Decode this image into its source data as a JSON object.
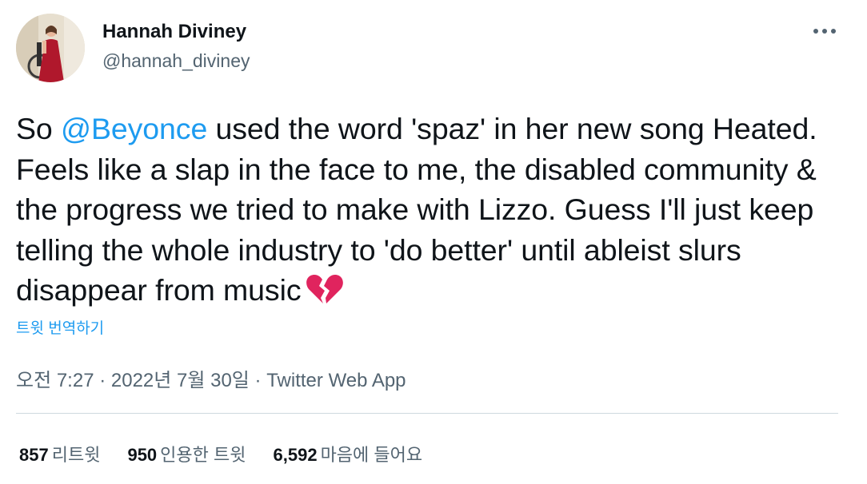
{
  "author": {
    "display_name": "Hannah Diviney",
    "handle": "@hannah_diviney"
  },
  "more_label": "•••",
  "tweet": {
    "prefix": "So ",
    "mention": "@Beyonce",
    "body": " used the word 'spaz' in her new song Heated. Feels like a slap in the face to me, the disabled community & the progress we tried to make with Lizzo. Guess I'll just keep telling the whole industry to 'do better' until ableist slurs disappear from music",
    "emoji": "broken-heart-icon"
  },
  "translate_label": "트윗 번역하기",
  "meta": {
    "time": "오전 7:27",
    "separator": " · ",
    "date": "2022년 7월 30일",
    "source": "Twitter Web App"
  },
  "stats": {
    "retweets": {
      "count": "857",
      "label": "리트윗"
    },
    "quotes": {
      "count": "950",
      "label": "인용한 트윗"
    },
    "likes": {
      "count": "6,592",
      "label": "마음에 들어요"
    }
  },
  "colors": {
    "accent": "#1d9bf0",
    "text": "#0f1419",
    "secondary": "#536471",
    "divider": "#cfd9de",
    "emoji": "#e0245e"
  }
}
